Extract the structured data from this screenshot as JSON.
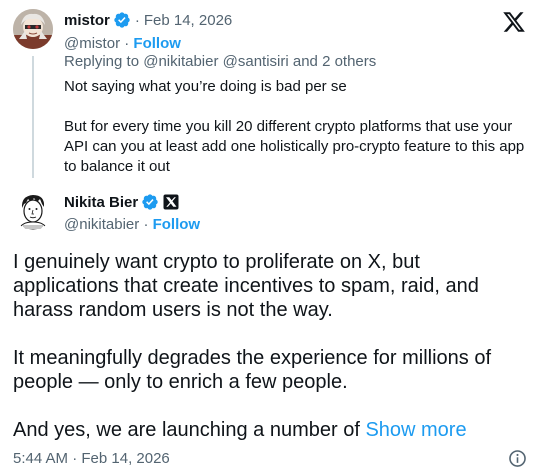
{
  "parent_tweet": {
    "author_name": "mistor",
    "date": "Feb 14, 2026",
    "handle": "@mistor",
    "follow_label": "Follow",
    "replying_to": "Replying to @nikitabier @santisiri and 2 others",
    "text_paragraphs": [
      "Not saying what you’re doing is bad per se",
      "But for every time you kill 20 different crypto platforms that use your API can you at least add one holistically pro-crypto feature to this app to balance it out"
    ]
  },
  "main_tweet": {
    "author_name": "Nikita Bier",
    "handle": "@nikitabier",
    "follow_label": "Follow",
    "text_paragraphs": [
      "I genuinely want crypto to proliferate on X, but applications that create incentives to spam, raid, and harass random users is not the way.",
      "It meaningfully degrades the experience for millions of people — only to enrich a few people."
    ],
    "truncated_text": "And yes, we are launching a number of",
    "show_more_label": "Show more",
    "timestamp": "5:44 AM · Feb 14, 2026"
  },
  "separators": {
    "dot": "·"
  },
  "icons": {
    "brand": "x-logo-icon",
    "verified": "verified-badge-icon",
    "affiliation": "x-affiliation-badge-icon",
    "info": "info-icon"
  },
  "colors": {
    "link": "#1d9bf0",
    "text": "#0f1419",
    "secondary": "#536471",
    "thread_line": "#cfd9de"
  }
}
